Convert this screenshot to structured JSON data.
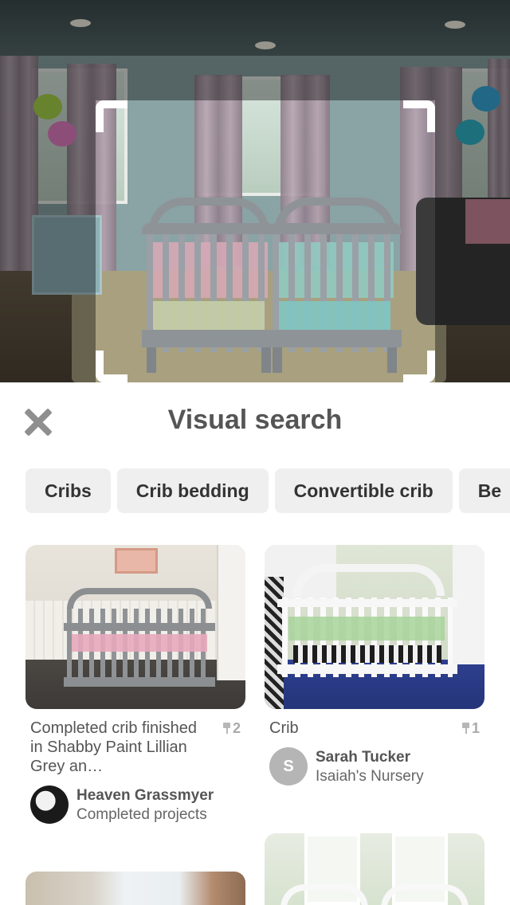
{
  "header": {
    "title": "Visual search",
    "close_icon": "close-icon"
  },
  "chips": [
    {
      "label": "Cribs"
    },
    {
      "label": "Crib bedding"
    },
    {
      "label": "Convertible crib"
    },
    {
      "label": "Be"
    }
  ],
  "pins": [
    {
      "title": "Completed crib finished in Shabby Paint Lillian Grey an…",
      "saves": "2",
      "user": "Heaven Grassmyer",
      "board": "Completed projects",
      "avatar_initial": ""
    },
    {
      "title": "Crib",
      "saves": "1",
      "user": "Sarah Tucker",
      "board": "Isaiah's Nursery",
      "avatar_initial": "S"
    }
  ],
  "colors": {
    "chip_bg": "#efefef",
    "avatar_s_bg": "#b5b5b5",
    "text_primary": "#555555"
  }
}
